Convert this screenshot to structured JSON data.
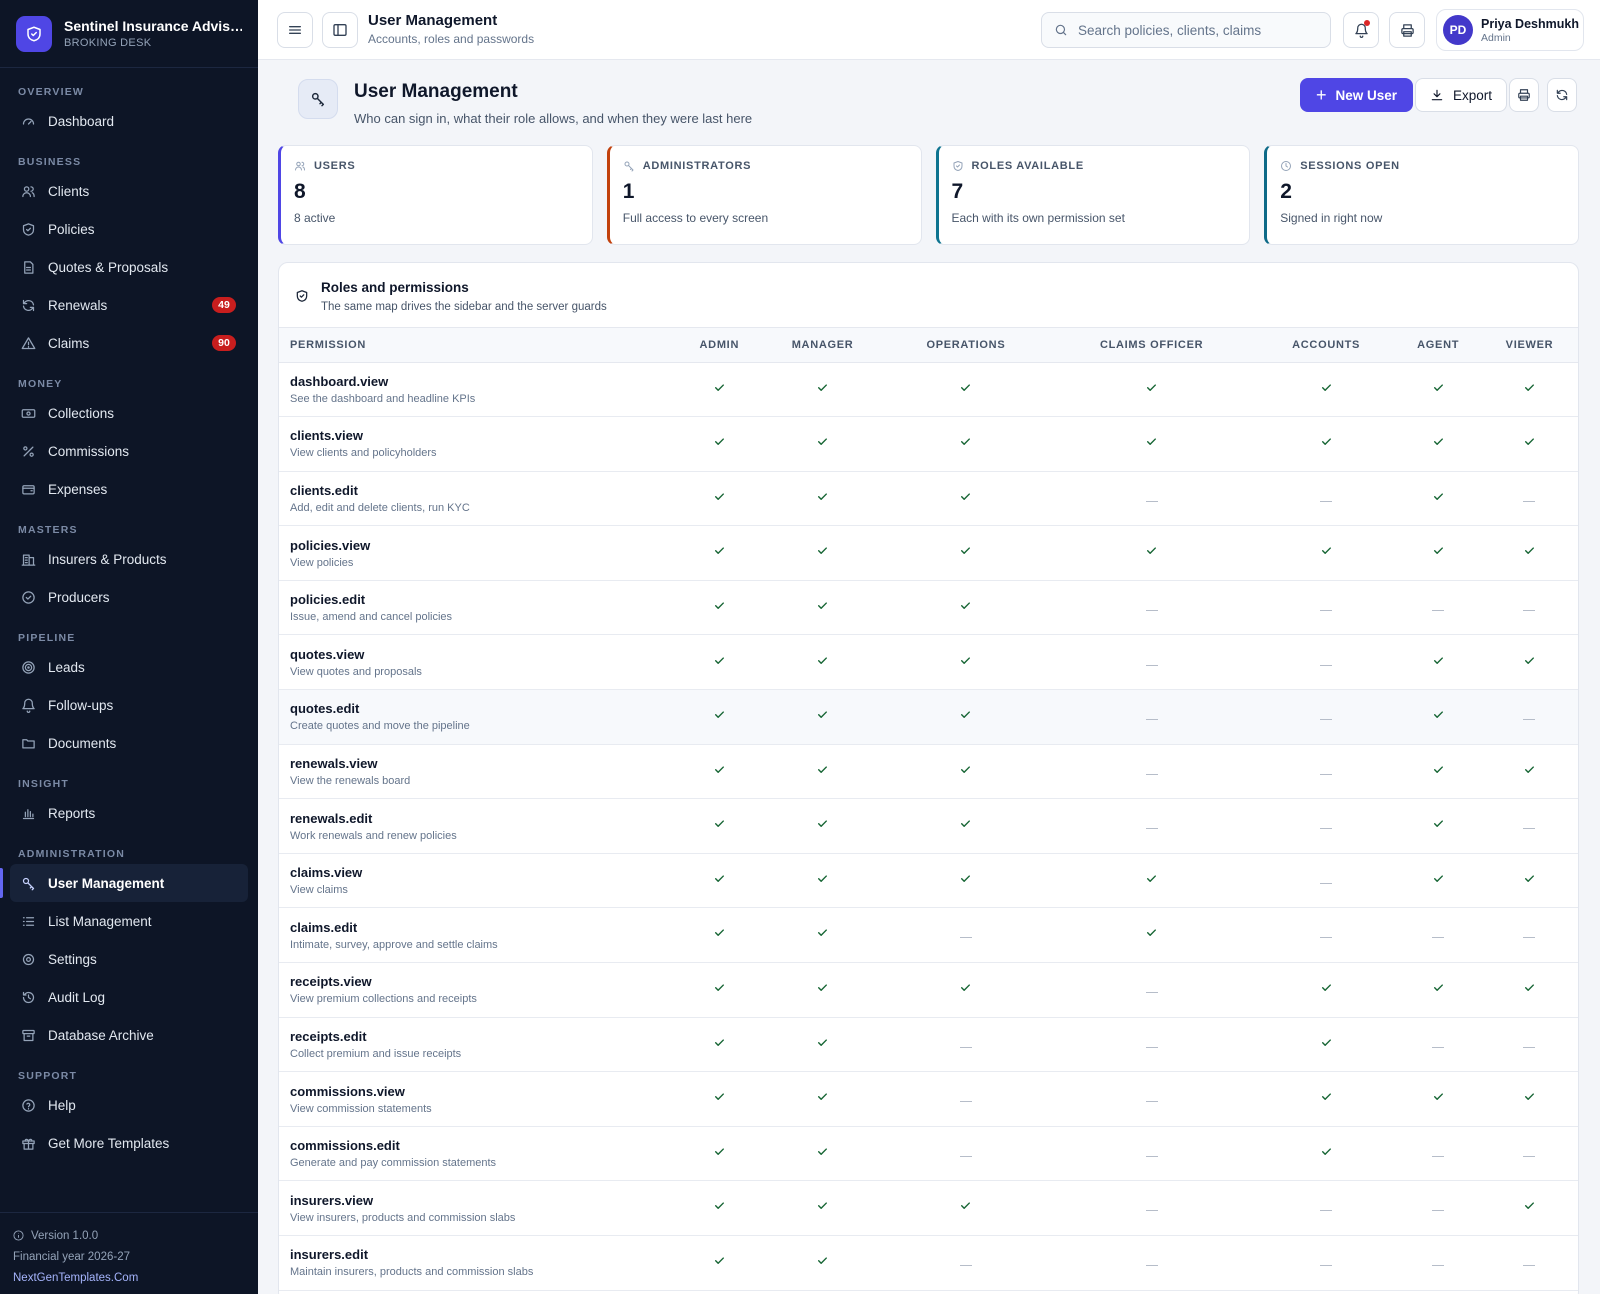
{
  "brand": {
    "name": "Sentinel Insurance Advisors",
    "sub": "BROKING DESK"
  },
  "nav": [
    {
      "section": "OVERVIEW",
      "items": [
        {
          "label": "Dashboard",
          "icon": "gauge-icon"
        }
      ]
    },
    {
      "section": "BUSINESS",
      "items": [
        {
          "label": "Clients",
          "icon": "users-icon"
        },
        {
          "label": "Policies",
          "icon": "shield-check-icon"
        },
        {
          "label": "Quotes & Proposals",
          "icon": "file-text-icon"
        },
        {
          "label": "Renewals",
          "icon": "refresh-icon",
          "badge": "49"
        },
        {
          "label": "Claims",
          "icon": "alert-triangle-icon",
          "badge": "90"
        }
      ]
    },
    {
      "section": "MONEY",
      "items": [
        {
          "label": "Collections",
          "icon": "banknote-icon"
        },
        {
          "label": "Commissions",
          "icon": "percent-icon"
        },
        {
          "label": "Expenses",
          "icon": "wallet-icon"
        }
      ]
    },
    {
      "section": "MASTERS",
      "items": [
        {
          "label": "Insurers & Products",
          "icon": "building-icon"
        },
        {
          "label": "Producers",
          "icon": "badge-check-icon"
        }
      ]
    },
    {
      "section": "PIPELINE",
      "items": [
        {
          "label": "Leads",
          "icon": "target-icon"
        },
        {
          "label": "Follow-ups",
          "icon": "bell-icon"
        },
        {
          "label": "Documents",
          "icon": "folder-icon"
        }
      ]
    },
    {
      "section": "INSIGHT",
      "items": [
        {
          "label": "Reports",
          "icon": "bar-chart-icon"
        }
      ]
    },
    {
      "section": "ADMINISTRATION",
      "items": [
        {
          "label": "User Management",
          "icon": "key-icon",
          "active": true
        },
        {
          "label": "List Management",
          "icon": "list-icon"
        },
        {
          "label": "Settings",
          "icon": "gear-icon"
        },
        {
          "label": "Audit Log",
          "icon": "history-icon"
        },
        {
          "label": "Database Archive",
          "icon": "archive-icon"
        }
      ]
    },
    {
      "section": "SUPPORT",
      "items": [
        {
          "label": "Help",
          "icon": "help-circle-icon"
        },
        {
          "label": "Get More Templates",
          "icon": "gift-icon"
        }
      ]
    }
  ],
  "footer": {
    "version": "Version 1.0.0",
    "fy": "Financial year 2026-27",
    "link": "NextGenTemplates.Com"
  },
  "topbar": {
    "title": "User Management",
    "subtitle": "Accounts, roles and passwords",
    "search_placeholder": "Search policies, clients, claims",
    "user_name": "Priya Deshmukh",
    "user_role": "Admin",
    "user_initials": "PD"
  },
  "page": {
    "title": "User Management",
    "subtitle": "Who can sign in, what their role allows, and when they were last here",
    "new_user_label": "New User",
    "export_label": "Export"
  },
  "kpis": [
    {
      "label": "USERS",
      "value": "8",
      "sub": "8 active",
      "color": "#4f46e5",
      "icon": "users-icon"
    },
    {
      "label": "ADMINISTRATORS",
      "value": "1",
      "sub": "Full access to every screen",
      "color": "#c2410c",
      "icon": "key-icon"
    },
    {
      "label": "ROLES AVAILABLE",
      "value": "7",
      "sub": "Each with its own permission set",
      "color": "#0e7490",
      "icon": "shield-check-icon"
    },
    {
      "label": "SESSIONS OPEN",
      "value": "2",
      "sub": "Signed in right now",
      "color": "#0e6a88",
      "icon": "clock-icon"
    }
  ],
  "permissions_panel": {
    "title": "Roles and permissions",
    "subtitle": "The same map drives the sidebar and the server guards",
    "permission_header": "PERMISSION",
    "roles": [
      "ADMIN",
      "MANAGER",
      "OPERATIONS",
      "CLAIMS OFFICER",
      "ACCOUNTS",
      "AGENT",
      "VIEWER"
    ],
    "rows": [
      {
        "code": "dashboard.view",
        "desc": "See the dashboard and headline KPIs",
        "grants": [
          1,
          1,
          1,
          1,
          1,
          1,
          1
        ]
      },
      {
        "code": "clients.view",
        "desc": "View clients and policyholders",
        "grants": [
          1,
          1,
          1,
          1,
          1,
          1,
          1
        ]
      },
      {
        "code": "clients.edit",
        "desc": "Add, edit and delete clients, run KYC",
        "grants": [
          1,
          1,
          1,
          0,
          0,
          1,
          0
        ]
      },
      {
        "code": "policies.view",
        "desc": "View policies",
        "grants": [
          1,
          1,
          1,
          1,
          1,
          1,
          1
        ]
      },
      {
        "code": "policies.edit",
        "desc": "Issue, amend and cancel policies",
        "grants": [
          1,
          1,
          1,
          0,
          0,
          0,
          0
        ]
      },
      {
        "code": "quotes.view",
        "desc": "View quotes and proposals",
        "grants": [
          1,
          1,
          1,
          0,
          0,
          1,
          1
        ]
      },
      {
        "code": "quotes.edit",
        "desc": "Create quotes and move the pipeline",
        "grants": [
          1,
          1,
          1,
          0,
          0,
          1,
          0
        ],
        "highlight": true
      },
      {
        "code": "renewals.view",
        "desc": "View the renewals board",
        "grants": [
          1,
          1,
          1,
          0,
          0,
          1,
          1
        ]
      },
      {
        "code": "renewals.edit",
        "desc": "Work renewals and renew policies",
        "grants": [
          1,
          1,
          1,
          0,
          0,
          1,
          0
        ]
      },
      {
        "code": "claims.view",
        "desc": "View claims",
        "grants": [
          1,
          1,
          1,
          1,
          0,
          1,
          1
        ]
      },
      {
        "code": "claims.edit",
        "desc": "Intimate, survey, approve and settle claims",
        "grants": [
          1,
          1,
          0,
          1,
          0,
          0,
          0
        ]
      },
      {
        "code": "receipts.view",
        "desc": "View premium collections and receipts",
        "grants": [
          1,
          1,
          1,
          0,
          1,
          1,
          1
        ]
      },
      {
        "code": "receipts.edit",
        "desc": "Collect premium and issue receipts",
        "grants": [
          1,
          1,
          0,
          0,
          1,
          0,
          0
        ]
      },
      {
        "code": "commissions.view",
        "desc": "View commission statements",
        "grants": [
          1,
          1,
          0,
          0,
          1,
          1,
          1
        ]
      },
      {
        "code": "commissions.edit",
        "desc": "Generate and pay commission statements",
        "grants": [
          1,
          1,
          0,
          0,
          1,
          0,
          0
        ]
      },
      {
        "code": "insurers.view",
        "desc": "View insurers, products and commission slabs",
        "grants": [
          1,
          1,
          1,
          0,
          0,
          0,
          1
        ]
      },
      {
        "code": "insurers.edit",
        "desc": "Maintain insurers, products and commission slabs",
        "grants": [
          1,
          1,
          0,
          0,
          0,
          0,
          0
        ]
      }
    ]
  },
  "colors": {
    "accent": "#4f46e5",
    "check": "#166534",
    "sidebar": "#0d1526"
  }
}
